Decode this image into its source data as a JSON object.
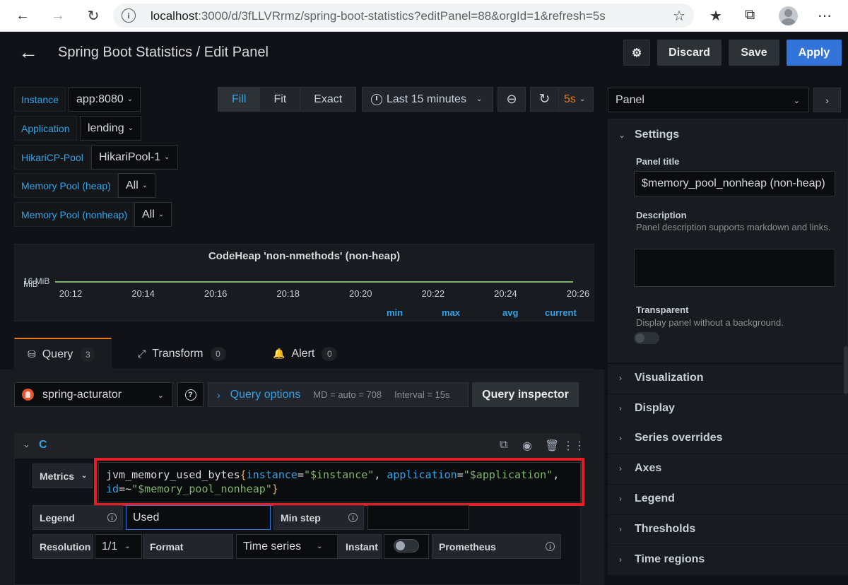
{
  "browser": {
    "url_host": "localhost",
    "url_rest": ":3000/d/3fLLVRrmz/spring-boot-statistics?editPanel=88&orgId=1&refresh=5s"
  },
  "header": {
    "title": "Spring Boot Statistics / Edit Panel",
    "discard_label": "Discard",
    "save_label": "Save",
    "apply_label": "Apply"
  },
  "variables": [
    {
      "label": "Instance",
      "value": "app:8080"
    },
    {
      "label": "Application",
      "value": "lending"
    },
    {
      "label": "HikariCP-Pool",
      "value": "HikariPool-1"
    },
    {
      "label": "Memory Pool (heap)",
      "value": "All"
    },
    {
      "label": "Memory Pool (nonheap)",
      "value": "All"
    }
  ],
  "view_modes": {
    "fill": "Fill",
    "fit": "Fit",
    "exact": "Exact",
    "active": "Fill"
  },
  "time_picker": {
    "range": "Last 15 minutes",
    "refresh": "5s"
  },
  "preview": {
    "title": "CodeHeap 'non-nmethods' (non-heap)",
    "y_tick_a": "16 MiB",
    "y_tick_b": "MiB",
    "legend": {
      "min": "min",
      "max": "max",
      "avg": "avg",
      "current": "current"
    }
  },
  "chart_data": {
    "type": "line",
    "title": "CodeHeap 'non-nmethods' (non-heap)",
    "categories": [
      "20:12",
      "20:14",
      "20:16",
      "20:18",
      "20:20",
      "20:22",
      "20:24",
      "20:26"
    ],
    "series": [
      {
        "name": "Used",
        "values": [
          16,
          16,
          16,
          16,
          16,
          16,
          16,
          16
        ]
      }
    ],
    "ylabel": "",
    "color": "#7eb26d"
  },
  "tabs": [
    {
      "label": "Query",
      "count": "3"
    },
    {
      "label": "Transform",
      "count": "0"
    },
    {
      "label": "Alert",
      "count": "0"
    }
  ],
  "query": {
    "datasource": "spring-acturator",
    "options_title": "Query options",
    "md": "MD = auto = 708",
    "interval": "Interval = 15s",
    "inspector": "Query inspector",
    "ref_id": "C",
    "metrics_label": "Metrics",
    "expr_fn": "jvm_memory_used_bytes",
    "expr_open": "{",
    "expr_l1": "instance",
    "expr_eq1": "=",
    "expr_v1": "\"$instance\"",
    "expr_sep1": ", ",
    "expr_l2": "application",
    "expr_eq2": "=",
    "expr_v2": "\"$application\"",
    "expr_sep2": ",",
    "expr_l3": "id",
    "expr_eq3": "=~",
    "expr_v3": "\"$memory_pool_nonheap\"",
    "expr_close": "}",
    "legend_label": "Legend",
    "legend_value": "Used",
    "min_step_label": "Min step",
    "resolution_label": "Resolution",
    "resolution_value": "1/1",
    "format_label": "Format",
    "format_value": "Time series",
    "instant_label": "Instant",
    "prometheus_label": "Prometheus"
  },
  "options": {
    "selector": "Panel",
    "settings_title": "Settings",
    "panel_title_label": "Panel title",
    "panel_title_value": "$memory_pool_nonheap (non-heap)",
    "description_label": "Description",
    "description_help": "Panel description supports markdown and links.",
    "transparent_label": "Transparent",
    "transparent_help": "Display panel without a background.",
    "sections": [
      "Visualization",
      "Display",
      "Series overrides",
      "Axes",
      "Legend",
      "Thresholds",
      "Time regions"
    ]
  }
}
